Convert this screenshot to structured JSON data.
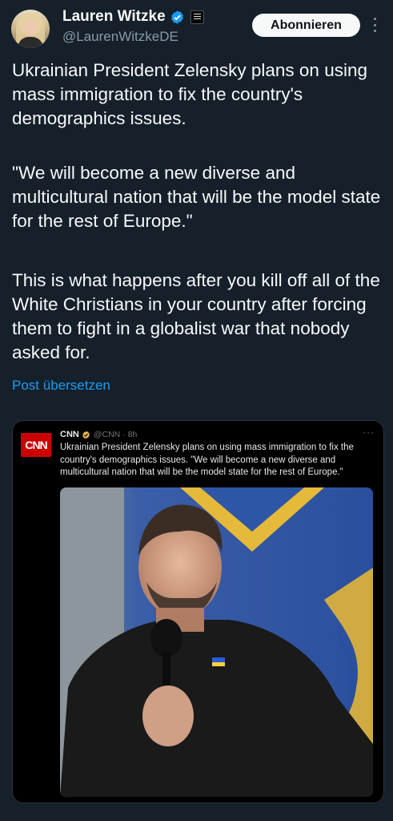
{
  "author": {
    "display_name": "Lauren Witzke",
    "handle": "@LaurenWitzkeDE",
    "verified_color": "#1d9bf0"
  },
  "follow_button": "Abonnieren",
  "tweet": {
    "paragraphs": [
      "Ukrainian President Zelensky plans on using mass immigration to fix the country's demographics issues.",
      "\"We will become a new diverse and multicultural nation that will be the model state for the rest of Europe.\"",
      "This is what happens after you kill off all of the White Christians in your country after forcing them to fight in a globalist war that nobody asked for."
    ],
    "translate_label": "Post übersetzen"
  },
  "embedded": {
    "logo_text": "CNN",
    "name": "CNN",
    "handle": "@CNN",
    "time": "8h",
    "more": "···",
    "text": "Ukrainian President Zelensky plans on using mass immigration to fix the country's demographics issues. \"We will become a new diverse and multicultural nation that will be the model state for the rest of Europe.\"",
    "logo_color": "#cc0000",
    "badge_color": "#e8b94a"
  },
  "colors": {
    "background": "#15202b",
    "link": "#1d9bf0",
    "muted": "#8b98a5"
  },
  "icons": [
    "verified-icon",
    "affiliation-icon",
    "more-icon",
    "gold-badge-icon"
  ]
}
